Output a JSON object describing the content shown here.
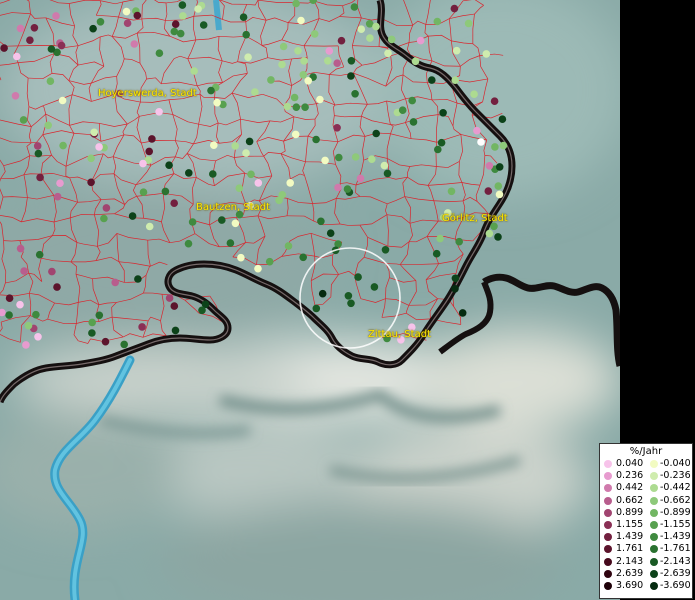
{
  "cities": [
    {
      "name": "Hoyerswerda, Stadt"
    },
    {
      "name": "Bautzen, Stadt"
    },
    {
      "name": "Görlitz, Stadt"
    },
    {
      "name": "Zittau, Stadt"
    }
  ],
  "legend": {
    "title": "%/Jahr",
    "positive": [
      "0.040",
      "0.236",
      "0.442",
      "0.662",
      "0.899",
      "1.155",
      "1.439",
      "1.761",
      "2.143",
      "2.639",
      "3.690"
    ],
    "negative": [
      "-0.040",
      "-0.236",
      "-0.442",
      "-0.662",
      "-0.899",
      "-1.155",
      "-1.439",
      "-1.761",
      "-2.143",
      "-2.639",
      "-3.690"
    ],
    "positive_colors": [
      "#f7c3ea",
      "#e79bcf",
      "#d07aac",
      "#b85d8d",
      "#a14470",
      "#8a2f55",
      "#73203f",
      "#5c142c",
      "#46091c",
      "#300410",
      "#1e0008"
    ],
    "negative_colors": [
      "#f2fbc2",
      "#cfecae",
      "#addb91",
      "#8ec97a",
      "#72b663",
      "#58a14f",
      "#3f8a3f",
      "#2a7230",
      "#195a24",
      "#0c4219",
      "#052b10"
    ]
  },
  "colors": {
    "background": "#8fb0ad",
    "region_border": "#d8262e",
    "country_border": "#1a1414",
    "river": "#46a8c8",
    "label": "#ffe800"
  }
}
